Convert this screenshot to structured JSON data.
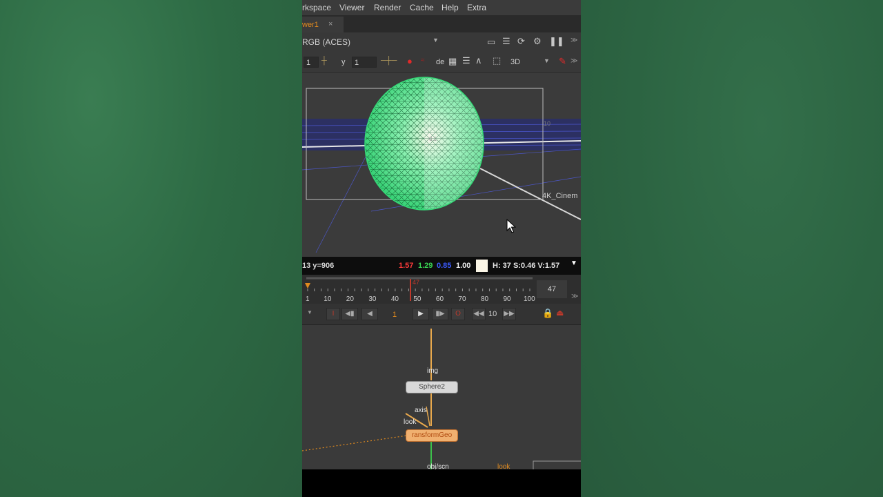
{
  "menu": [
    "rkspace",
    "Viewer",
    "Render",
    "Cache",
    "Help",
    "Extra"
  ],
  "tab": {
    "label": "wer1",
    "close": "×"
  },
  "viewer_toolbar": {
    "colorspace": "RGB (ACES)",
    "x_value": "1",
    "y_label": "y",
    "y_value": "1",
    "mode_label": "de",
    "view_mode": "3D"
  },
  "viewport": {
    "format_label": "4K_Cinem",
    "grid_label": "10",
    "center_label": "0.1"
  },
  "info": {
    "coords": "13 y=906",
    "r": "1.57",
    "g": "1.29",
    "b": "0.85",
    "a": "1.00",
    "hsv": "H: 37 S:0.46 V:1.57"
  },
  "timeline": {
    "ticks": [
      "1",
      "10",
      "20",
      "30",
      "40",
      "50",
      "60",
      "70",
      "80",
      "90",
      "100"
    ],
    "current_marker": "47",
    "frame_field": "47"
  },
  "transport": {
    "frame": "1",
    "increment": "10"
  },
  "nodes": {
    "img_label": "img",
    "sphere": "Sphere2",
    "axis_label": "axis",
    "look_label": "look",
    "transform": "ransformGeo",
    "obj_label": "obj/scn",
    "look2_label": "look"
  },
  "colors": {
    "accent": "#e08a1e",
    "sphere_wire": "#5ef09a",
    "red_value": "#ff3b3b",
    "green_value": "#39d353",
    "blue_value": "#3b5bff"
  }
}
